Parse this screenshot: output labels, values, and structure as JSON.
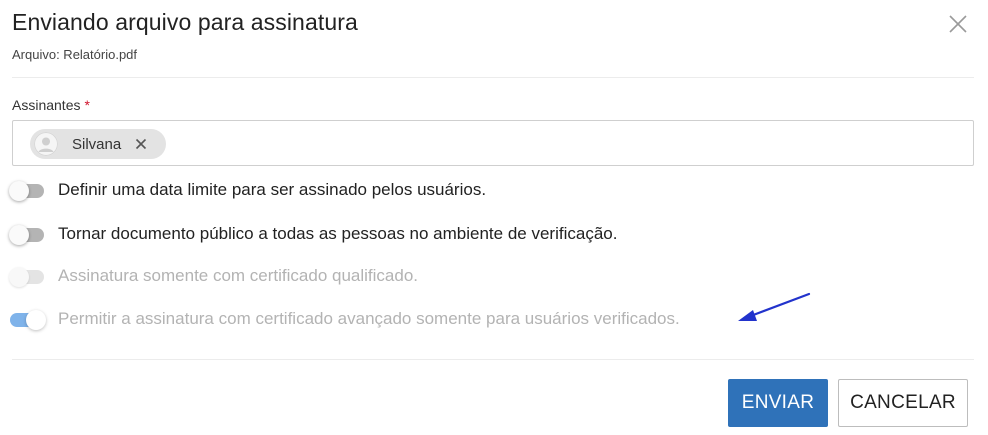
{
  "dialog": {
    "title": "Enviando arquivo para assinatura",
    "subtitle": "Arquivo: Relatório.pdf"
  },
  "signers": {
    "label": "Assinantes",
    "required_mark": "*",
    "chips": [
      {
        "name": "Silvana"
      }
    ]
  },
  "options": [
    {
      "label": "Definir uma data limite para ser assinado pelos usuários.",
      "checked": false,
      "disabled": false
    },
    {
      "label": "Tornar documento público a todas as pessoas no ambiente de verificação.",
      "checked": false,
      "disabled": false
    },
    {
      "label": "Assinatura somente com certificado qualificado.",
      "checked": false,
      "disabled": true
    },
    {
      "label": "Permitir a assinatura com certificado avançado somente para usuários verificados.",
      "checked": true,
      "disabled": true
    }
  ],
  "actions": {
    "submit_label": "ENVIAR",
    "cancel_label": "CANCELAR"
  },
  "colors": {
    "primary": "#2f72b9",
    "annotation_arrow": "#2233cc",
    "required": "#d0142c"
  },
  "icons": {
    "close": "close-icon",
    "avatar": "user-avatar-icon",
    "chip_remove": "close-icon",
    "annotation": "arrow-icon"
  }
}
